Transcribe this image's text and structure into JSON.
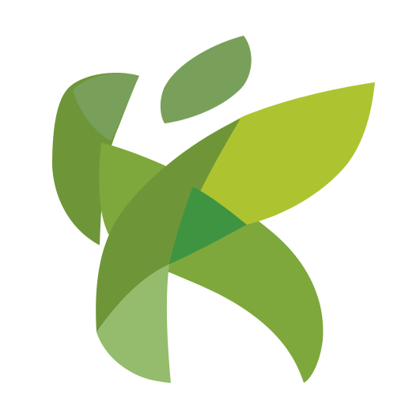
{
  "logo": {
    "name": "green-leaf-figure-logo",
    "colors": {
      "dark_green": "#6e9638",
      "mid_green": "#7ea83b",
      "light_green": "#94bc6c",
      "lime": "#adc430",
      "sage": "#78a05a",
      "overlap_green": "#3e9441"
    }
  }
}
